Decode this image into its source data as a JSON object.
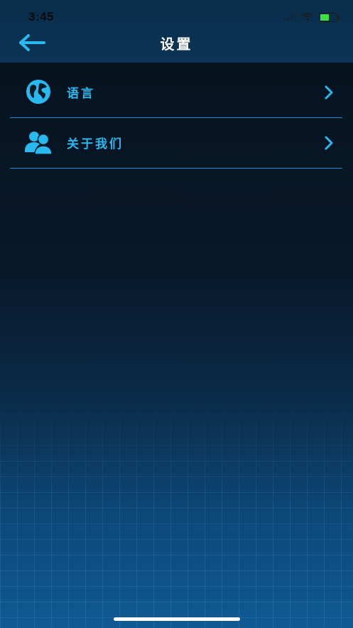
{
  "status_bar": {
    "time": "3:45",
    "icons": [
      "signal-icon",
      "wifi-icon",
      "battery-charging-icon"
    ]
  },
  "nav": {
    "title": "设置",
    "back_icon": "arrow-left-icon"
  },
  "settings": {
    "items": [
      {
        "label": "语言",
        "icon": "globe-icon"
      },
      {
        "label": "关于我们",
        "icon": "people-icon"
      }
    ],
    "chevron_icon": "chevron-right-icon"
  },
  "colors": {
    "accent": "#2ab8f0",
    "divider": "#1a8fd6",
    "header_bg": "#0b3456",
    "background_top": "#06121c",
    "background_bottom": "#0f5a94"
  }
}
